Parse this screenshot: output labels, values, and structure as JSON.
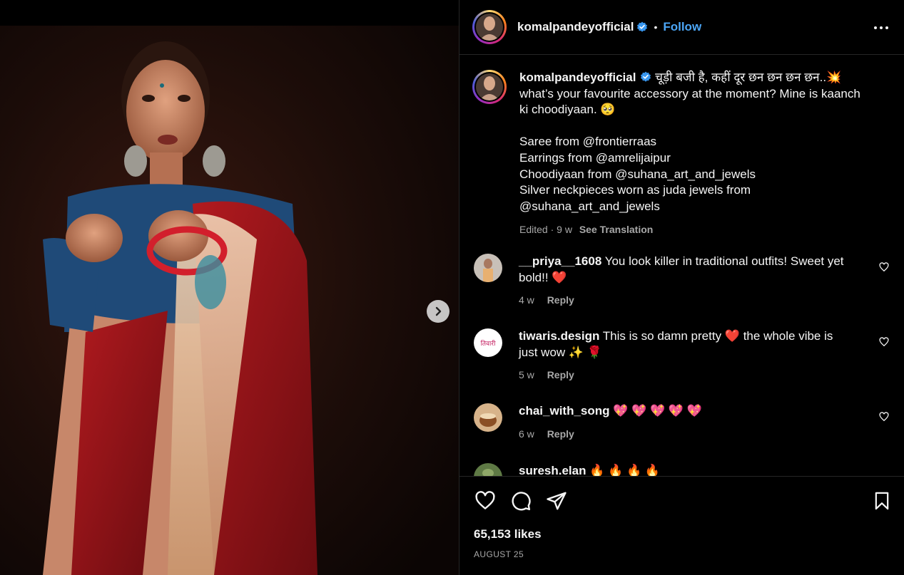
{
  "post": {
    "author": "komalpandeyofficial",
    "follow_label": "Follow",
    "separator": "•",
    "caption_lead": "चूड़ी बजी है, कहीं दूर छन छन छन छन..💥",
    "caption_lines": [
      "what’s your favourite accessory at the moment? Mine is kaanch",
      "ki choodiyaan. 🥺",
      "",
      "Saree from @frontierraas",
      "Earrings from @amrelijaipur",
      "Choodiyaan from @suhana_art_and_jewels",
      "Silver neckpieces worn as juda jewels from",
      "@suhana_art_and_jewels"
    ],
    "edited_meta": "Edited · 9 w",
    "see_translation": "See Translation",
    "likes": "65,153 likes",
    "date": "AUGUST 25"
  },
  "comments": [
    {
      "user": "__priya__1608",
      "text": "You look killer in traditional outfits! Sweet yet bold!! ",
      "emoji": "❤️",
      "age": "4 w",
      "reply": "Reply"
    },
    {
      "user": "tiwaris.design",
      "text": "This is so damn pretty ",
      "emoji": "❤️",
      "text2": " the whole vibe is just wow ✨ 🌹",
      "age": "5 w",
      "reply": "Reply"
    },
    {
      "user": "chai_with_song",
      "text": " 💖 💖 💖 💖 💖",
      "age": "6 w",
      "reply": "Reply"
    },
    {
      "user": "suresh.elan",
      "text": " 🔥 🔥 🔥 🔥"
    }
  ],
  "colors": {
    "accent": "#4ca6f6",
    "like": "#ff3040",
    "muted": "#a8a8a8",
    "background": "#000000"
  },
  "icons": [
    "verified-badge-icon",
    "more-options-icon",
    "chevron-right-icon",
    "heart-icon",
    "comment-icon",
    "share-icon",
    "bookmark-icon"
  ]
}
